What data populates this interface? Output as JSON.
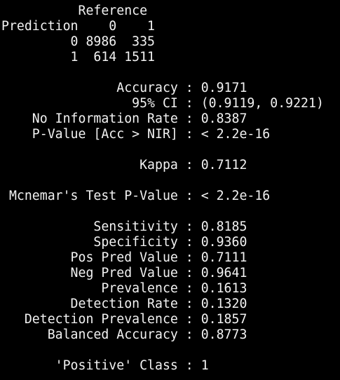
{
  "theme": {
    "background": "#000000",
    "text": "#f2f2f2"
  },
  "confusion_matrix": {
    "header_reference": "          Reference",
    "header_prediction": "Prediction    0    1",
    "row_0": "         0 8986  335",
    "row_1": "         1  614 1511"
  },
  "statistics": {
    "accuracy": "               Accuracy : 0.9171",
    "ci": "                 95% CI : (0.9119, 0.9221)",
    "nir": "    No Information Rate : 0.8387",
    "pvalue": "    P-Value [Acc > NIR] : < 2.2e-16",
    "kappa": "                  Kappa : 0.7112",
    "mcnemar": " Mcnemar's Test P-Value : < 2.2e-16",
    "sensitivity": "            Sensitivity : 0.8185",
    "specificity": "            Specificity : 0.9360",
    "pos_pred": "         Pos Pred Value : 0.7111",
    "neg_pred": "         Neg Pred Value : 0.9641",
    "prevalence": "             Prevalence : 0.1613",
    "detection_rate": "         Detection Rate : 0.1320",
    "detection_prevalence": "   Detection Prevalence : 0.1857",
    "balanced_accuracy": "      Balanced Accuracy : 0.8773",
    "positive_class": "       'Positive' Class : 1"
  }
}
